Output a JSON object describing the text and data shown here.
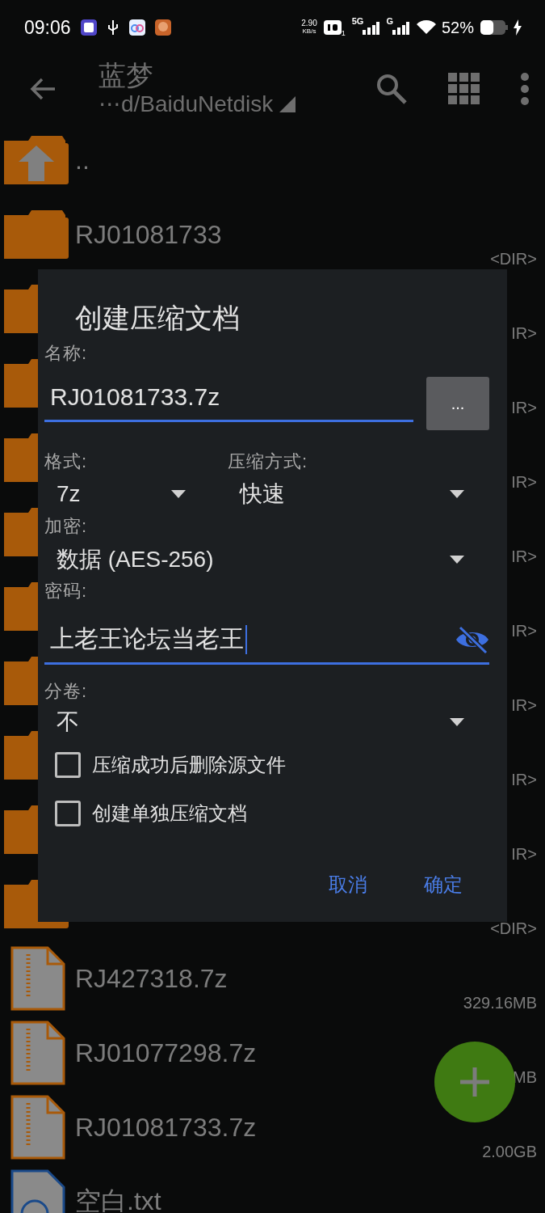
{
  "status_bar": {
    "time": "09:06",
    "net_speed": "2.90",
    "net_unit": "KB/s",
    "hd_index": "1",
    "network_1": "5G",
    "network_2": "G",
    "battery": "52%",
    "charging": true
  },
  "app_bar": {
    "title": "蓝梦",
    "path": "⋯d/BaiduNetdisk"
  },
  "files": [
    {
      "kind": "up",
      "name": ".."
    },
    {
      "kind": "folder",
      "name": "RJ01081733",
      "size": "<DIR>"
    },
    {
      "kind": "folder",
      "size": "IR>"
    },
    {
      "kind": "folder",
      "size": "IR>"
    },
    {
      "kind": "folder",
      "size": "IR>"
    },
    {
      "kind": "folder",
      "size": "IR>"
    },
    {
      "kind": "folder",
      "size": "IR>"
    },
    {
      "kind": "folder",
      "size": "IR>"
    },
    {
      "kind": "folder",
      "size": "IR>"
    },
    {
      "kind": "folder",
      "size": "IR>"
    },
    {
      "kind": "folder",
      "size": "<DIR>"
    },
    {
      "kind": "archive",
      "name": "RJ427318.7z",
      "size": "329.16MB"
    },
    {
      "kind": "archive",
      "name": "RJ01077298.7z",
      "size": "MB"
    },
    {
      "kind": "archive",
      "name": "RJ01081733.7z",
      "size": "2.00GB"
    },
    {
      "kind": "text",
      "name": "空白.txt"
    }
  ],
  "dialog": {
    "title": "创建压缩文档",
    "name_label": "名称:",
    "name_value": "RJ01081733.7z",
    "browse_button": "...",
    "format_label": "格式:",
    "format_value": "7z",
    "method_label": "压缩方式:",
    "method_value": "快速",
    "encryption_label": "加密:",
    "encryption_value": "数据 (AES-256)",
    "password_label": "密码:",
    "password_value": "上老王论坛当老王",
    "password_visible": true,
    "split_label": "分卷:",
    "split_value": "不",
    "options": [
      {
        "label": "压缩成功后删除源文件",
        "checked": false
      },
      {
        "label": "创建单独压缩文档",
        "checked": false
      }
    ],
    "buttons": [
      "取消",
      "确定"
    ]
  }
}
